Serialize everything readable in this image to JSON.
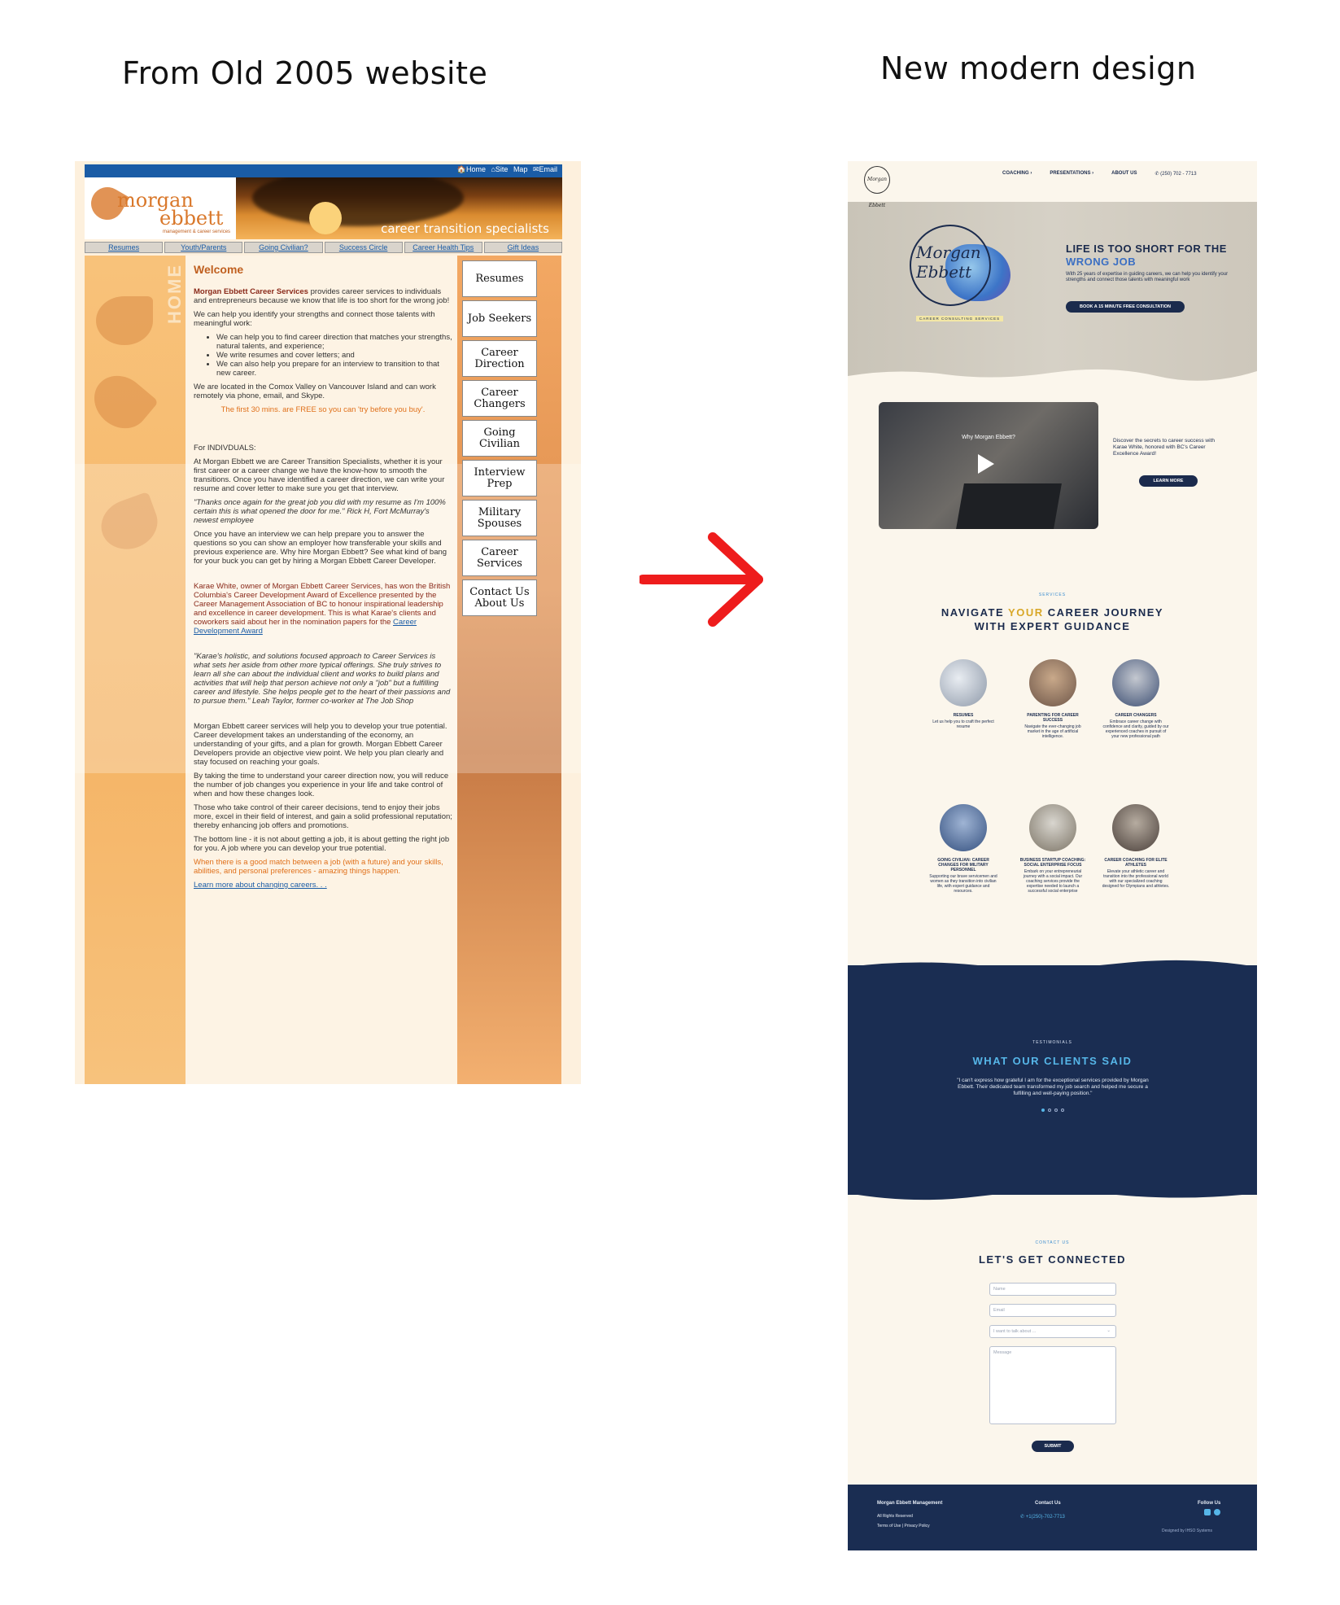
{
  "headings": {
    "old": "From Old 2005 website",
    "new": "New modern design"
  },
  "old_site": {
    "top_links": "🏠Home  ⌂Site Map  ✉Email",
    "logo_name_1": "morgan",
    "logo_name_2": "ebbett",
    "logo_sub": "management & career services",
    "banner_tag": "career transition specialists",
    "nav": [
      "Resumes",
      "Youth/Parents",
      "Going Civilian?",
      "Success Circle",
      "Career Health Tips",
      "Gift Ideas"
    ],
    "side_label": "HOME",
    "welcome": "Welcome",
    "p1_strong": "Morgan Ebbett Career Services",
    "p1_rest": " provides career services to individuals and entrepreneurs because we know that life is too short for the wrong job!",
    "p2": "We can help you identify your strengths and connect those talents with meaningful work:",
    "bullets": [
      "We can help you to find career direction that matches your strengths, natural talents, and experience;",
      "We write resumes and cover letters; and",
      "We can also help you prepare for an interview to transition to that new career."
    ],
    "p3": "We are located in the Comox Valley on Vancouver Island and can work remotely via phone, email, and Skype.",
    "free": "The first 30 mins. are FREE so you can 'try before you buy'.",
    "indiv_label": "For INDIVDUALS:",
    "p4": "At Morgan Ebbett we are Career Transition Specialists, whether it is your first career or a career change we have the know-how to smooth the transitions. Once you have identified a career direction, we can write your resume and cover letter to make sure you get that interview.",
    "quote1": "\"Thanks once again for the great job you did with my resume as I'm 100% certain this is what opened the door for me.\" Rick H, Fort McMurray's newest employee",
    "p5": "Once you have an interview we can help prepare you to answer the questions so you can show an employer how transferable your skills and previous experience are. Why hire Morgan Ebbett? See what kind of bang for your buck you can get by hiring a Morgan Ebbett Career Developer.",
    "p6": "Karae White, owner of Morgan Ebbett Career Services, has won the British Columbia's Career Development Award of Excellence presented by the Career Management Association of BC to honour inspirational leadership and excellence in career development. This is what Karae's clients and coworkers said about her in the nomination papers for the ",
    "p6_link": "Career Development Award",
    "quote2": "\"Karae's holistic, and solutions focused approach to Career Services is what sets her aside from other more typical offerings. She truly strives to learn all she can about the individual client and works to build plans and activities that will help that person achieve not only a \"job\" but a fulfilling career and lifestyle. She helps people get to the heart of their passions and to pursue them.\" Leah Taylor, former co-worker at The Job Shop",
    "p7": "Morgan Ebbett career services will help you to develop your true potential. Career development takes an understanding of the economy, an understanding of your gifts, and a plan for growth. Morgan Ebbett Career Developers provide an objective view point. We help you plan clearly and stay focused on reaching your goals.",
    "p8": "By taking the time to understand your career direction now, you will reduce the number of job changes you experience in your life and take control of when and how these changes look.",
    "p9": "Those who take control of their career decisions, tend to enjoy their jobs more, excel in their field of interest, and gain a solid professional reputation; thereby enhancing job offers and promotions.",
    "p10": "The bottom line - it is not about getting a job, it is about getting the right job for you. A job where you can develop your true potential.",
    "p11": "When there is a good match between a job (with a future) and your skills, abilities, and personal preferences - amazing things happen.",
    "learn_more": "Learn more about changing careers. . .",
    "side_buttons": [
      "Resumes",
      "Job Seekers",
      "Career Direction",
      "Career Changers",
      "Going Civilian",
      "Interview Prep",
      "Military Spouses",
      "Career Services",
      "Contact Us About Us"
    ]
  },
  "new_site": {
    "logo_text": "Morgan Ebbett",
    "menu": [
      "COACHING ›",
      "PRESENTATIONS ›",
      "ABOUT US"
    ],
    "phone": "✆ (250) 702 - 7713",
    "hero_logo": "Morgan\nEbbett",
    "hero_ccs": "CAREER CONSULTING SERVICES",
    "hero_title_1": "LIFE IS TOO SHORT FOR THE",
    "hero_title_2": "WRONG JOB",
    "hero_body": "With 25 years of expertise in guiding careers, we can help you identify your strengths and connect those talents with meaningful work",
    "hero_btn": "BOOK A 15 MINUTE FREE CONSULTATION",
    "video_title": "Why Morgan Ebbett?",
    "discover": "Discover the secrets to career success with Karae White, honored with BC's Career Excellence Award!",
    "learn_more": "LEARN MORE",
    "services_kicker": "SERVICES",
    "services_title_1": "NAVIGATE ",
    "services_title_y": "YOUR",
    "services_title_2": " CAREER JOURNEY",
    "services_title_3": "WITH EXPERT GUIDANCE",
    "services": [
      {
        "title": "RESUMES",
        "desc": "Let us help you to craft the perfect resume"
      },
      {
        "title": "PARENTING FOR CAREER SUCCESS",
        "desc": "Navigate the ever-changing job market in the age of artificial intelligence."
      },
      {
        "title": "CAREER CHANGERS",
        "desc": "Embrace career change with confidence and clarity, guided by our experienced coaches in pursuit of your new professional path"
      },
      {
        "title": "GOING CIVILIAN: CAREER CHANGES FOR MILITARY PERSONNEL",
        "desc": "Supporting our brave servicemen and women as they transition into civilian life, with expert guidance and resources."
      },
      {
        "title": "BUSINESS STARTUP COACHING: SOCIAL ENTERPRISE FOCUS",
        "desc": "Embark on your entrepreneurial journey with a social impact. Our coaching services provide the expertise needed to launch a successful social enterprise"
      },
      {
        "title": "CAREER COACHING FOR ELITE ATHLETES",
        "desc": "Elevate your athletic career and transition into the professional world with our specialized coaching designed for Olympians and athletes."
      }
    ],
    "testimonials_kicker": "TESTIMONIALS",
    "testimonials_title": "WHAT OUR CLIENTS SAID",
    "testimonial_quote": "\"I can't express how grateful I am for the exceptional services provided by Morgan Ebbett. Their dedicated team transformed my job search and helped me secure a fulfilling and well-paying position.\"",
    "contact_kicker": "CONTACT US",
    "contact_title": "LET'S GET CONNECTED",
    "form": {
      "name": "Name",
      "email": "Email",
      "select": "I want to talk about ...",
      "message": "Message",
      "submit": "SUBMIT"
    },
    "footer": {
      "company": "Morgan Ebbett Management",
      "rights": "All Rights Reserved",
      "terms": "Terms of Use | Privacy Policy",
      "contact_label": "Contact Us",
      "phone": "✆ +1(250)-702-7713",
      "follow": "Follow Us",
      "designed": "Designed by IHSO Systems"
    },
    "colors": {
      "navy": "#1a2d52",
      "accent_blue": "#56b6e8",
      "gold": "#d8a727",
      "cream": "#fbf6ec"
    }
  },
  "arrow_color": "#ee1c1c"
}
